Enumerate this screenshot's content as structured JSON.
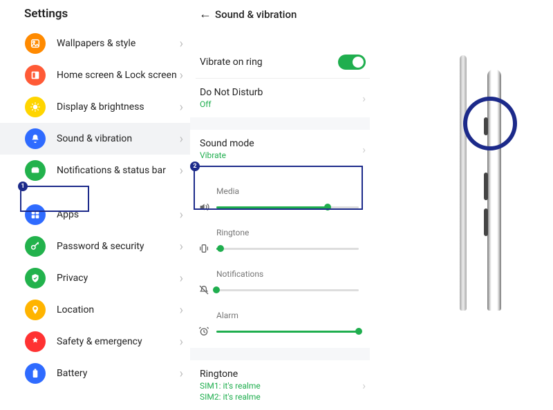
{
  "settings": {
    "title": "Settings",
    "items": [
      {
        "label": "Wallpapers & style"
      },
      {
        "label": "Home screen & Lock screen"
      },
      {
        "label": "Display & brightness"
      },
      {
        "label": "Sound & vibration"
      },
      {
        "label": "Notifications & status bar"
      },
      {
        "label": "Apps"
      },
      {
        "label": "Password & security"
      },
      {
        "label": "Privacy"
      },
      {
        "label": "Location"
      },
      {
        "label": "Safety & emergency"
      },
      {
        "label": "Battery"
      }
    ]
  },
  "sound": {
    "title": "Sound & vibration",
    "vibrate_on_ring": {
      "label": "Vibrate on ring",
      "value": true
    },
    "dnd": {
      "label": "Do Not Disturb",
      "sub": "Off"
    },
    "sound_mode": {
      "label": "Sound mode",
      "sub": "Vibrate"
    },
    "sliders": {
      "media": {
        "label": "Media",
        "percent": 78
      },
      "ringtone": {
        "label": "Ringtone",
        "percent": 3
      },
      "notifications": {
        "label": "Notifications",
        "percent": 0
      },
      "alarm": {
        "label": "Alarm",
        "percent": 100
      }
    },
    "ringtone": {
      "label": "Ringtone",
      "sim1": "SIM1: it's realme",
      "sim2": "SIM2: it's realme"
    }
  },
  "highlights": {
    "badge1": "1",
    "badge2": "2"
  }
}
